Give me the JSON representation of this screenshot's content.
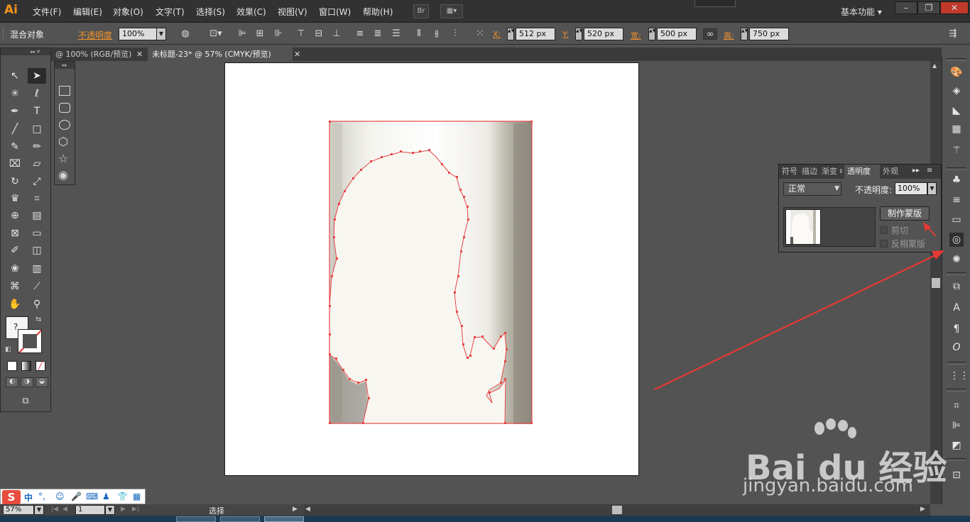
{
  "app": {
    "logo": "Ai",
    "workspace": "基本功能",
    "bridge_label": "Br"
  },
  "menu": [
    "文件(F)",
    "编辑(E)",
    "对象(O)",
    "文字(T)",
    "选择(S)",
    "效果(C)",
    "视图(V)",
    "窗口(W)",
    "帮助(H)"
  ],
  "control": {
    "selection_label": "混合对象",
    "opacity_label": "不透明度",
    "opacity_value": "100%",
    "x_label": "X:",
    "x_value": "512 px",
    "y_label": "Y:",
    "y_value": "520 px",
    "w_label": "宽:",
    "w_value": "500 px",
    "h_label": "高:",
    "h_value": "750 px"
  },
  "tabs": [
    {
      "label": "@ 100% (RGB/预览)"
    },
    {
      "label": "未标题-23* @ 57% (CMYK/预览)"
    }
  ],
  "status": {
    "zoom": "57%",
    "page": "1",
    "tool": "选择"
  },
  "transparency_panel": {
    "tabs": [
      "符号",
      "描边",
      "渐变",
      "透明度",
      "外观"
    ],
    "blend_mode": "正常",
    "opacity_label": "不透明度:",
    "opacity_value": "100%",
    "make_mask": "制作蒙版",
    "clip": "剪切",
    "invert_mask": "反相蒙版"
  },
  "watermark": {
    "brand": "Bai du 经验",
    "url": "jingyan.baidu.com"
  },
  "ime": {
    "mode": "中"
  },
  "colors": {
    "accent": "#f0932b",
    "path": "#e84545",
    "arrow": "#e53935"
  }
}
